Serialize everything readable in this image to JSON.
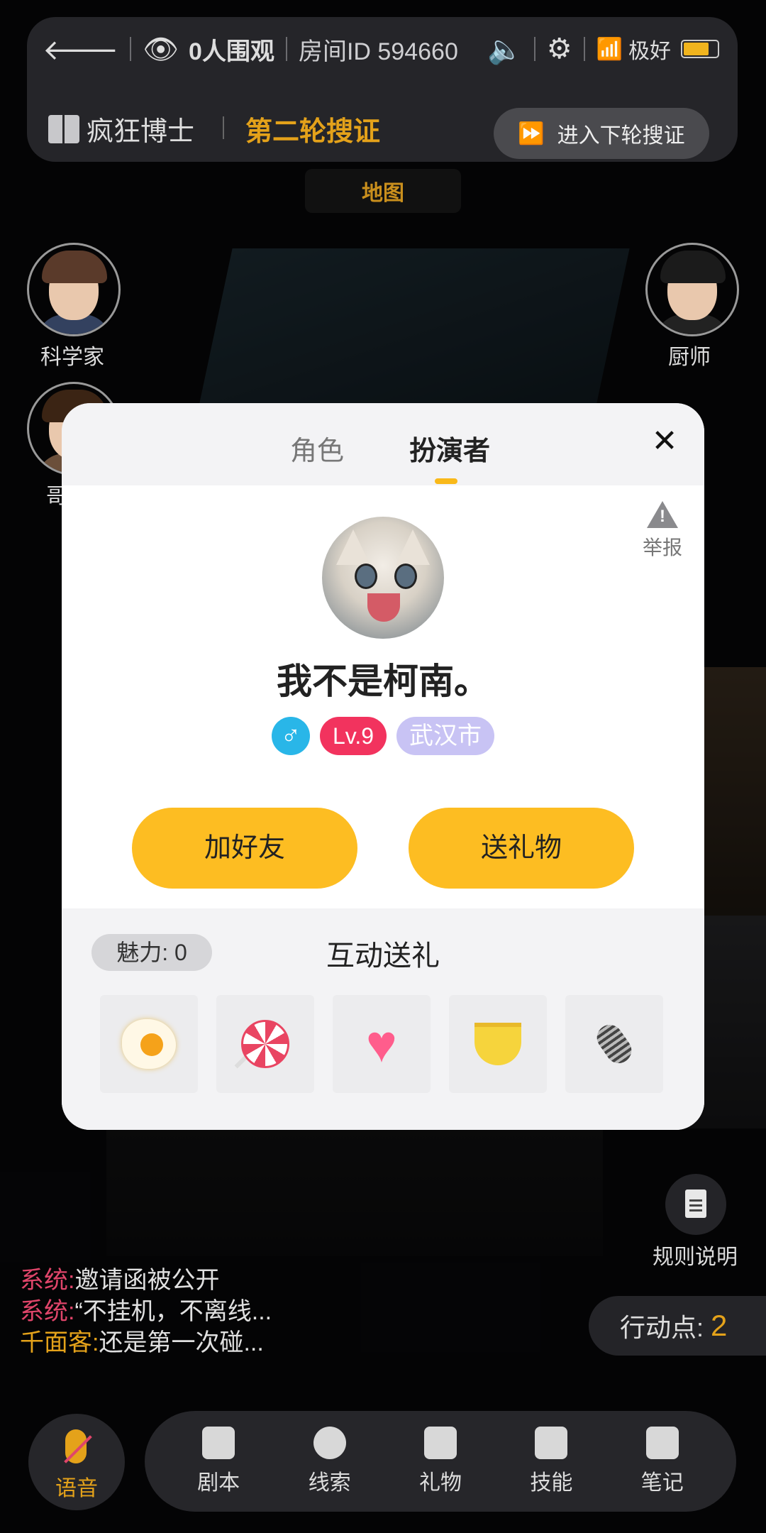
{
  "topbar": {
    "spectators": "0人围观",
    "room_id": "房间ID 594660",
    "signal_label": "极好",
    "script_name": "疯狂博士",
    "round_label": "第二轮搜证",
    "next_round_label": "进入下轮搜证",
    "icons": [
      "back-arrow-icon",
      "eye-icon",
      "speaker-icon",
      "gear-icon",
      "wifi-icon",
      "battery-icon",
      "book-icon",
      "fast-forward-icon"
    ]
  },
  "map_tab": "地图",
  "players": [
    {
      "name": "科学家"
    },
    {
      "name": "厨师"
    },
    {
      "name": "哥"
    }
  ],
  "modal": {
    "tabs": [
      "角色",
      "扮演者"
    ],
    "active_tab": "扮演者",
    "report_label": "举报",
    "username": "我不是柯南。",
    "gender_symbol": "♂",
    "level": "Lv.9",
    "city": "武汉市",
    "add_friend_label": "加好友",
    "send_gift_label": "送礼物",
    "charm_label": "魅力: 0",
    "gift_title": "互动送礼",
    "gifts": [
      "fried-egg",
      "lollipop",
      "winged-heart",
      "banana",
      "microphone"
    ]
  },
  "rules_label": "规则说明",
  "chat": [
    {
      "sender": "系统:",
      "message": "邀请函被公开"
    },
    {
      "sender": "系统:",
      "message": "“不挂机，不离线..."
    },
    {
      "sender": "千面客:",
      "message": "还是第一次碰..."
    }
  ],
  "action_points": {
    "label": "行动点:",
    "value": "2"
  },
  "bottom_nav": {
    "voice_label": "语音",
    "items": [
      "剧本",
      "线索",
      "礼物",
      "技能",
      "笔记"
    ]
  },
  "colors": {
    "accent": "#fdbd22",
    "gold_text": "#e4a21a",
    "system_red": "#e0456a",
    "level_pink": "#f2335e",
    "city_lilac": "#c8c3f4",
    "gender_blue": "#29b6e8"
  }
}
